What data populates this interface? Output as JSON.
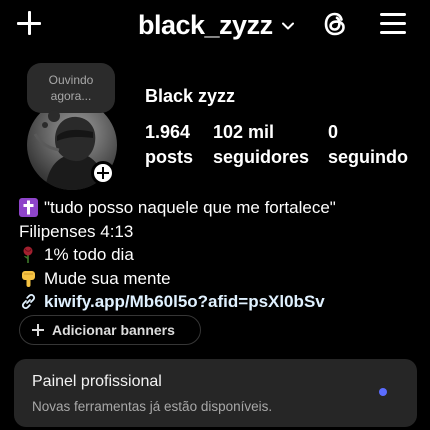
{
  "header": {
    "username": "black_zyzz",
    "icons": [
      "plus-icon",
      "chevron-down-icon",
      "threads-icon",
      "menu-icon"
    ]
  },
  "note": {
    "text_line1": "Ouvindo",
    "text_line2": "agora..."
  },
  "profile": {
    "display_name": "Black zyzz",
    "stats": [
      {
        "value": "1.964",
        "label": "posts"
      },
      {
        "value": "102 mil",
        "label": "seguidores"
      },
      {
        "value": "0",
        "label": "seguindo"
      }
    ]
  },
  "bio": {
    "line1": "\"tudo posso naquele que me fortalece\"",
    "line2": "Filipenses 4:13",
    "line3": "1% todo dia",
    "line4": "Mude sua mente",
    "link": "kiwify.app/Mb60l5o?afid=psXl0bSv",
    "emojis": [
      "latin-cross-icon",
      "wilted-rose-icon",
      "pointing-down-icon",
      "link-icon"
    ]
  },
  "banners": {
    "add_label": "Adicionar banners"
  },
  "panel": {
    "title": "Painel profissional",
    "subtitle": "Novas ferramentas já estão disponíveis.",
    "dot_color": "#5b6cff"
  },
  "colors": {
    "background": "#000000",
    "surface": "#262626",
    "link": "#e0f1ff"
  }
}
